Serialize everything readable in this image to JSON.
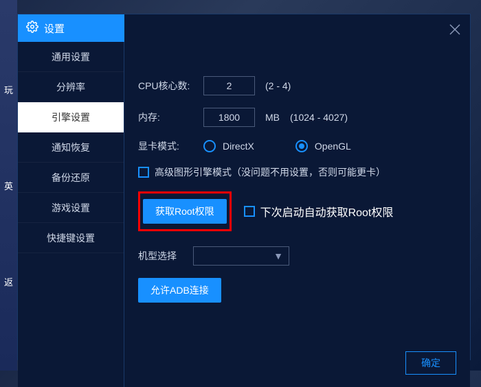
{
  "title": "设置",
  "sidebar": {
    "items": [
      {
        "label": "通用设置"
      },
      {
        "label": "分辨率"
      },
      {
        "label": "引擎设置"
      },
      {
        "label": "通知恢复"
      },
      {
        "label": "备份还原"
      },
      {
        "label": "游戏设置"
      },
      {
        "label": "快捷键设置"
      }
    ]
  },
  "content": {
    "cpu": {
      "label": "CPU核心数:",
      "value": "2",
      "hint": "(2 - 4)"
    },
    "memory": {
      "label": "内存:",
      "value": "1800",
      "unit": "MB",
      "hint": "(1024 - 4027)"
    },
    "gpu": {
      "label": "显卡模式:",
      "options": {
        "directx": "DirectX",
        "opengl": "OpenGL"
      }
    },
    "advanced": {
      "label": "高级图形引擎模式（没问题不用设置，否则可能更卡）"
    },
    "root": {
      "button": "获取Root权限",
      "checkbox": "下次启动自动获取Root权限"
    },
    "model": {
      "label": "机型选择"
    },
    "adb": {
      "button": "允许ADB连接"
    }
  },
  "footer": {
    "confirm": "确定"
  },
  "bg_chars": {
    "a": "玩",
    "b": "英",
    "c": "返"
  }
}
